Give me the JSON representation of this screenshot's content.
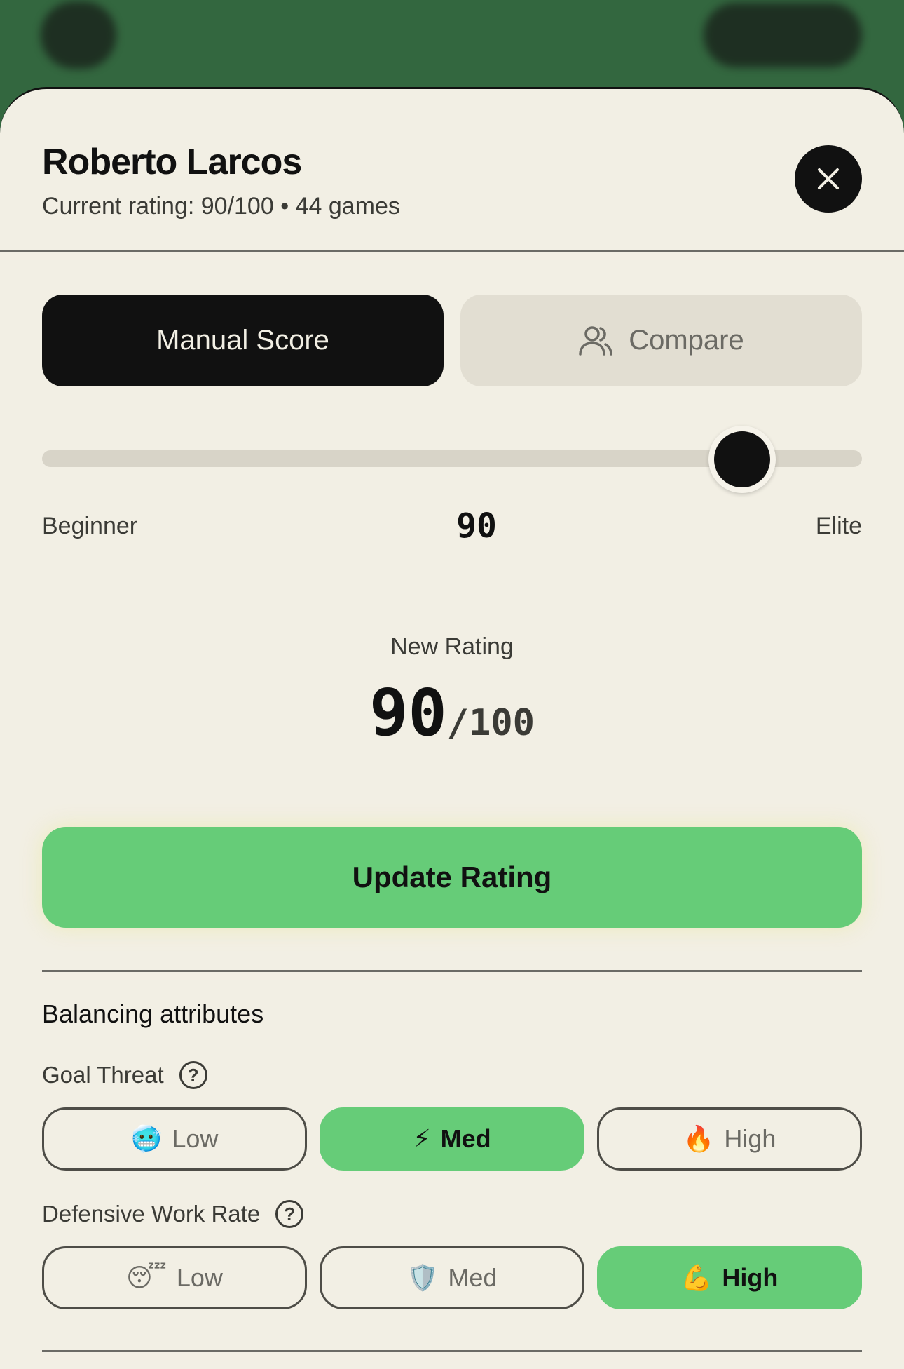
{
  "player": {
    "name": "Roberto Larcos",
    "subtitle": "Current rating: 90/100 • 44 games"
  },
  "tabs": {
    "manual": "Manual Score",
    "compare": "Compare",
    "active": "manual"
  },
  "slider": {
    "min_label": "Beginner",
    "max_label": "Elite",
    "value": "90",
    "level": 0.9
  },
  "new_rating": {
    "label": "New Rating",
    "value": "90",
    "max": "/100"
  },
  "update_button": "Update Rating",
  "attributes": {
    "section_title": "Balancing attributes",
    "goal_threat": {
      "label": "Goal Threat",
      "help": "?",
      "options": [
        {
          "emoji": "🥶",
          "label": "Low",
          "selected": false
        },
        {
          "emoji": "⚡",
          "label": "Med",
          "selected": true
        },
        {
          "emoji": "🔥",
          "label": "High",
          "selected": false
        }
      ]
    },
    "defensive_work_rate": {
      "label": "Defensive Work Rate",
      "help": "?",
      "options": [
        {
          "emoji": "😴",
          "label": "Low",
          "selected": false
        },
        {
          "emoji": "🛡️",
          "label": "Med",
          "selected": false
        },
        {
          "emoji": "💪",
          "label": "High",
          "selected": true
        }
      ]
    }
  },
  "icons": {
    "close": "close-icon",
    "compare": "users-icon",
    "help": "help-circle-icon"
  },
  "colors": {
    "header_bg": "#33673f",
    "sheet_bg": "#f2efe4",
    "accent_green": "#66cc78",
    "dark": "#111111"
  }
}
